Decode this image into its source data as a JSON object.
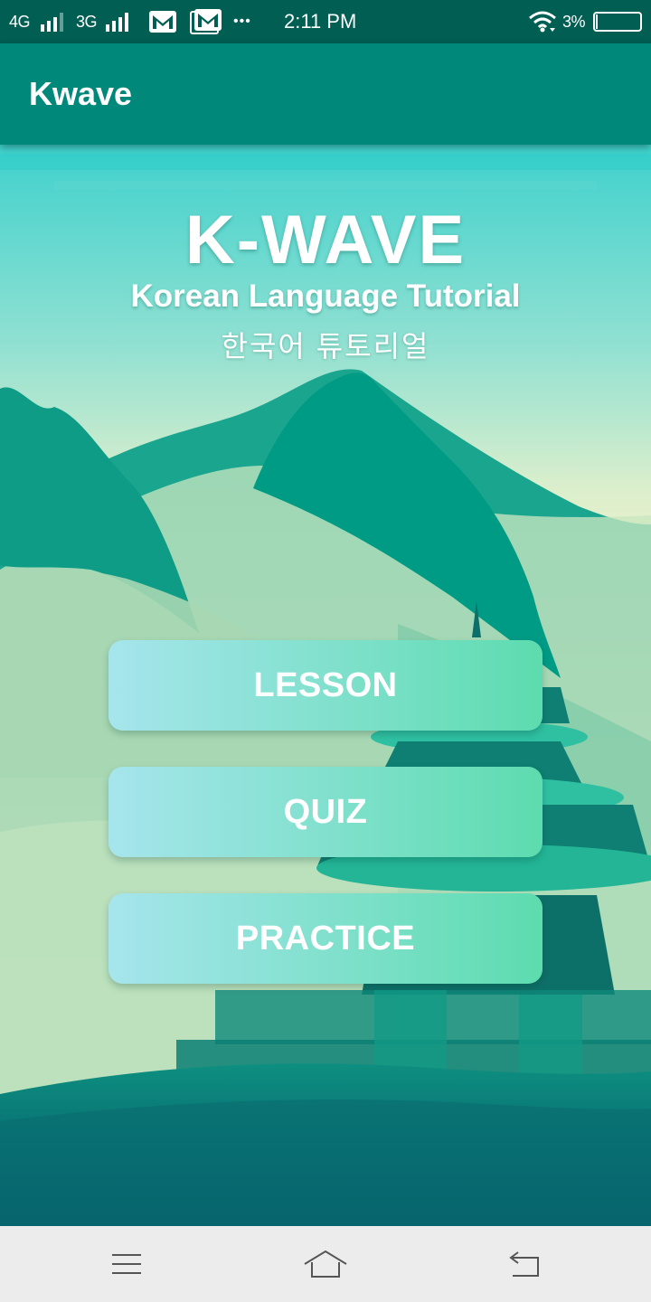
{
  "status_bar": {
    "network_1": "4G",
    "network_2": "3G",
    "more_dots": "•••",
    "time": "2:11 PM",
    "battery_percent": "3%",
    "battery_level": 0.03,
    "icons": [
      "signal-4g-icon",
      "signal-3g-icon",
      "gmail-icon",
      "gmail-icon",
      "wifi-icon",
      "battery-icon"
    ]
  },
  "app_bar": {
    "title": "Kwave"
  },
  "hero": {
    "title": "K-WAVE",
    "subtitle": "Korean Language Tutorial",
    "korean": "한국어 튜토리얼"
  },
  "menu": {
    "lesson_label": "LESSON",
    "quiz_label": "QUIZ",
    "practice_label": "PRACTICE"
  },
  "nav_bar": {
    "icons": [
      "menu-icon",
      "home-icon",
      "back-icon"
    ]
  },
  "colors": {
    "status_bar": "#005e52",
    "app_bar": "#00897b",
    "button_gradient_start": "#a6e5ec",
    "button_gradient_end": "#5ddcaf",
    "nav_bar": "#ececec"
  }
}
